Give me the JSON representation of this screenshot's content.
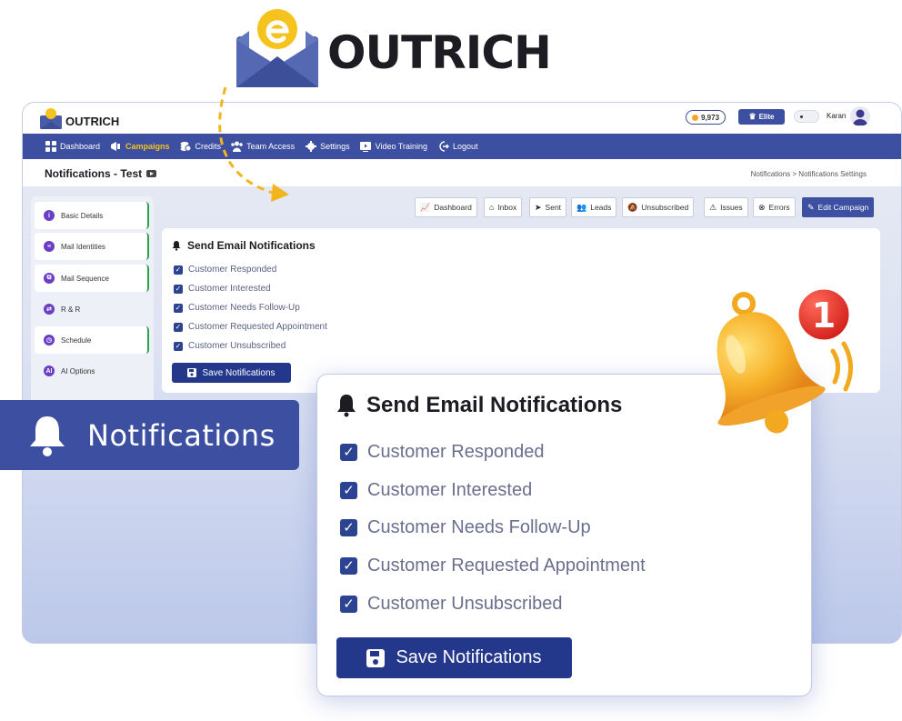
{
  "brand": {
    "name": "OUTRICH"
  },
  "app": {
    "logo_text": "OUTRICH",
    "credits": "9,973",
    "plan": "Elite",
    "user": "Karan"
  },
  "nav": [
    {
      "label": "Dashboard",
      "icon": "dashboard-icon"
    },
    {
      "label": "Campaigns",
      "icon": "megaphone-icon",
      "active": true
    },
    {
      "label": "Credits",
      "icon": "coins-icon"
    },
    {
      "label": "Team Access",
      "icon": "team-icon"
    },
    {
      "label": "Settings",
      "icon": "gear-icon"
    },
    {
      "label": "Video Training",
      "icon": "video-icon"
    },
    {
      "label": "Logout",
      "icon": "logout-icon"
    }
  ],
  "page": {
    "title": "Notifications - Test",
    "breadcrumb": "Notifications > Notifications Settings"
  },
  "sidebar": {
    "items": [
      {
        "label": "Basic Details",
        "icon": "info-icon",
        "done": true
      },
      {
        "label": "Mail Identities",
        "icon": "identity-icon",
        "done": true
      },
      {
        "label": "Mail Sequence",
        "icon": "sequence-icon",
        "done": true
      },
      {
        "label": "R & R",
        "icon": "reply-icon",
        "done": false
      },
      {
        "label": "Schedule",
        "icon": "schedule-icon",
        "done": true
      },
      {
        "label": "AI Options",
        "icon": "ai-icon",
        "done": false
      }
    ]
  },
  "toolbar": [
    {
      "label": "Dashboard",
      "icon": "chart-icon"
    },
    {
      "label": "Inbox",
      "icon": "inbox-icon"
    },
    {
      "label": "Sent",
      "icon": "send-icon"
    },
    {
      "label": "Leads",
      "icon": "users-icon"
    },
    {
      "label": "Unsubscribed",
      "icon": "bell-off-icon"
    },
    {
      "label": "Issues",
      "icon": "warning-icon"
    },
    {
      "label": "Errors",
      "icon": "error-icon"
    },
    {
      "label": "Edit Campaign",
      "icon": "edit-icon",
      "primary": true
    }
  ],
  "notifications": {
    "title": "Send Email Notifications",
    "options": [
      {
        "label": "Customer Responded",
        "checked": true
      },
      {
        "label": "Customer Interested",
        "checked": true
      },
      {
        "label": "Customer Needs Follow-Up",
        "checked": true
      },
      {
        "label": "Customer Requested Appointment",
        "checked": true
      },
      {
        "label": "Customer Unsubscribed",
        "checked": true
      }
    ],
    "save_label": "Save Notifications"
  },
  "feature_label": "Notifications",
  "bell_badge": "1",
  "colors": {
    "primary": "#3d4fa0",
    "button": "#23378b",
    "accent": "#f6c21d",
    "success": "#2aa44a"
  }
}
